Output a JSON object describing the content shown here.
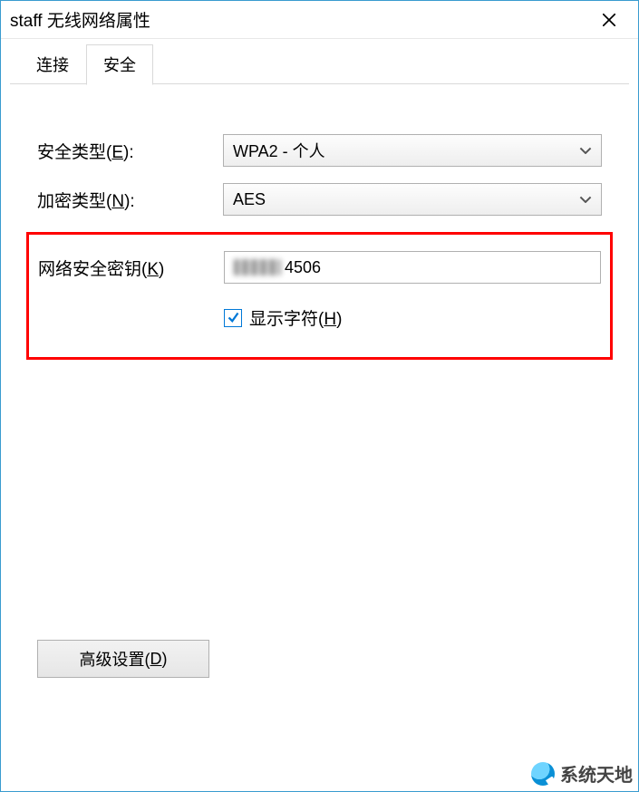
{
  "window": {
    "title": "staff 无线网络属性"
  },
  "tabs": {
    "connect": "连接",
    "security": "安全"
  },
  "form": {
    "security_type": {
      "label_prefix": "安全类型(",
      "mnemonic": "E",
      "label_suffix": "):",
      "value": "WPA2 - 个人"
    },
    "encryption_type": {
      "label_prefix": "加密类型(",
      "mnemonic": "N",
      "label_suffix": "):",
      "value": "AES"
    },
    "security_key": {
      "label_prefix": "网络安全密钥(",
      "mnemonic": "K",
      "label_suffix": ")",
      "visible_part": "4506"
    },
    "show_chars": {
      "label_prefix": "显示字符(",
      "mnemonic": "H",
      "label_suffix": ")",
      "checked": true
    }
  },
  "buttons": {
    "advanced": {
      "label_prefix": "高级设置(",
      "mnemonic": "D",
      "label_suffix": ")"
    }
  },
  "watermark": {
    "text": "系统天地"
  }
}
